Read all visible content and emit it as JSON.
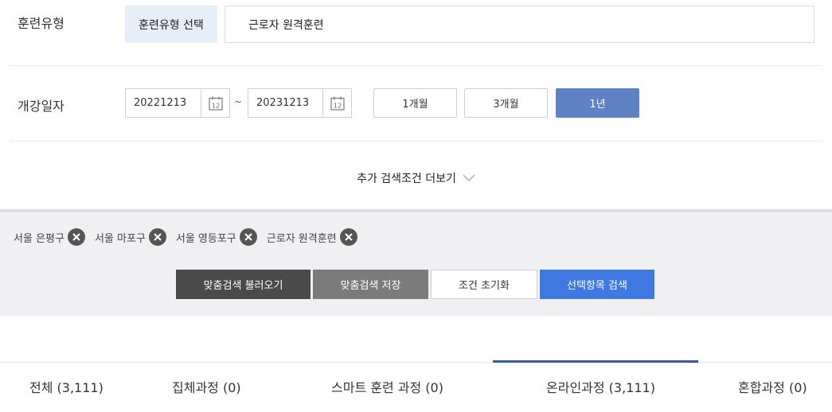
{
  "training_type": {
    "label": "훈련유형",
    "select_button": "훈련유형 선택",
    "selected_value": "근로자 원격훈련"
  },
  "open_date": {
    "label": "개강일자",
    "start": "20221213",
    "separator": "~",
    "end": "20231213",
    "calendar_icon_text": "12",
    "periods": [
      "1개월",
      "3개월",
      "1년"
    ],
    "active_period": "1년"
  },
  "more_conditions": "추가 검색조건 더보기",
  "chips": [
    {
      "label": "서울 은평구"
    },
    {
      "label": "서울 마포구"
    },
    {
      "label": "서울 영등포구"
    },
    {
      "label": "근로자 원격훈련"
    }
  ],
  "actions": {
    "load_custom": "맞춤검색 불러오기",
    "save_custom": "맞춤검색 저장",
    "reset": "조건 초기화",
    "search": "선택항목 검색"
  },
  "tabs": [
    {
      "label": "전체 (3,111)"
    },
    {
      "label": "집체과정 (0)"
    },
    {
      "label": "스마트 훈련 과정 (0)"
    },
    {
      "label": "온라인과정 (3,111)"
    },
    {
      "label": "혼합과정 (0)"
    }
  ],
  "active_tab": "온라인과정 (3,111)",
  "colors": {
    "accent_blue": "#3f78e0",
    "active_period": "#5f82c4",
    "chip_bg": "#e6eefa",
    "tab_indicator": "#3a5aa0"
  }
}
